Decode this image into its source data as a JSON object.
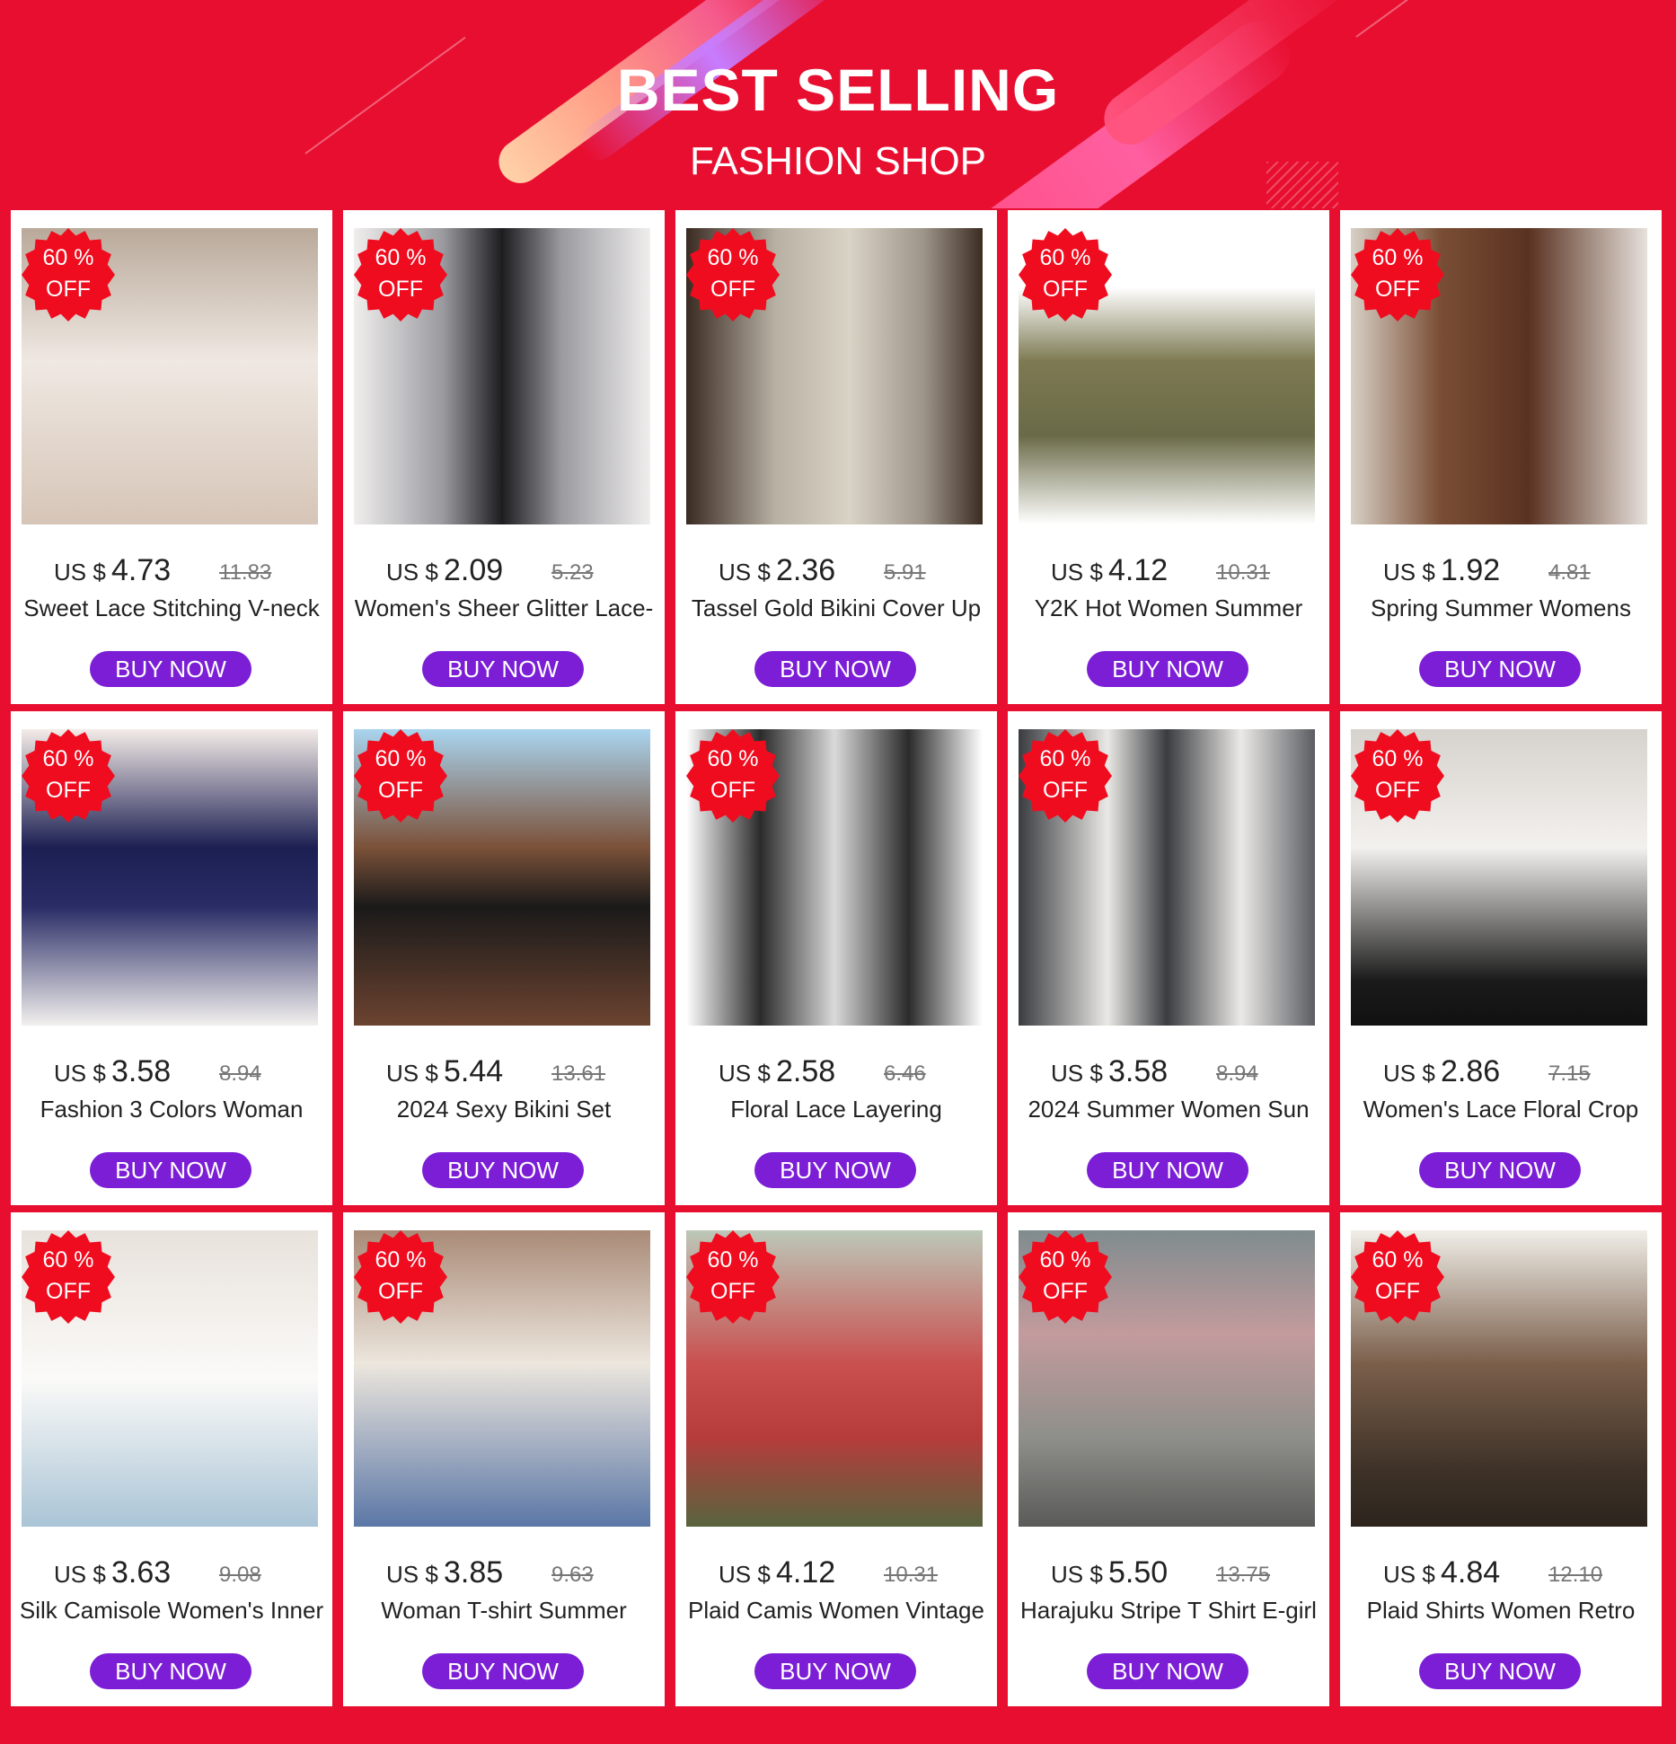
{
  "header": {
    "title": "BEST SELLING",
    "subtitle": "FASHION SHOP"
  },
  "badge": {
    "line1": "60 %",
    "line2": "OFF"
  },
  "currency": "US $",
  "buy_label": "BUY NOW",
  "colors": {
    "background": "#e80e30",
    "button": "#7b1ed6",
    "badge": "#ef0c1f"
  },
  "products": [
    {
      "price": "4.73",
      "old_price": "11.83",
      "title": "Sweet Lace Stitching V-neck"
    },
    {
      "price": "2.09",
      "old_price": "5.23",
      "title": "Women's Sheer Glitter Lace-"
    },
    {
      "price": "2.36",
      "old_price": "5.91",
      "title": "Tassel Gold Bikini Cover Up"
    },
    {
      "price": "4.12",
      "old_price": "10.31",
      "title": "Y2K Hot Women Summer"
    },
    {
      "price": "1.92",
      "old_price": "4.81",
      "title": "Spring Summer Womens"
    },
    {
      "price": "3.58",
      "old_price": "8.94",
      "title": "Fashion 3 Colors Woman"
    },
    {
      "price": "5.44",
      "old_price": "13.61",
      "title": "2024 Sexy Bikini Set"
    },
    {
      "price": "2.58",
      "old_price": "6.46",
      "title": "Floral Lace Layering"
    },
    {
      "price": "3.58",
      "old_price": "8.94",
      "title": "2024 Summer Women Sun"
    },
    {
      "price": "2.86",
      "old_price": "7.15",
      "title": "Women's Lace Floral Crop"
    },
    {
      "price": "3.63",
      "old_price": "9.08",
      "title": "Silk Camisole Women's Inner"
    },
    {
      "price": "3.85",
      "old_price": "9.63",
      "title": "Woman T-shirt Summer"
    },
    {
      "price": "4.12",
      "old_price": "10.31",
      "title": "Plaid Camis Women Vintage"
    },
    {
      "price": "5.50",
      "old_price": "13.75",
      "title": "Harajuku Stripe T Shirt E-girl"
    },
    {
      "price": "4.84",
      "old_price": "12.10",
      "title": "Plaid Shirts Women Retro"
    }
  ]
}
